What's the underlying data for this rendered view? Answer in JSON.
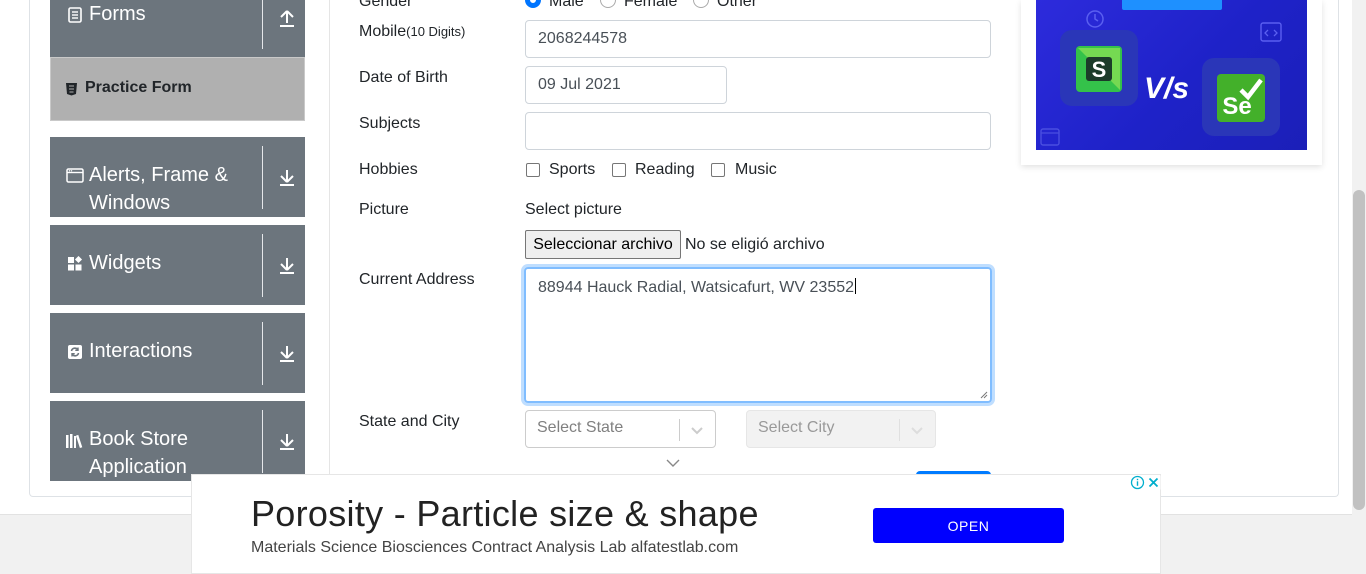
{
  "sidebar": {
    "groups": [
      {
        "title": "Forms",
        "icon": "form-icon"
      },
      {
        "title": "Alerts, Frame &",
        "title2": "Windows",
        "icon": "browser-window-icon"
      },
      {
        "title": "Widgets",
        "icon": "widgets-icon"
      },
      {
        "title": "Interactions",
        "icon": "interactions-icon"
      },
      {
        "title": "Book Store",
        "title2": "Application",
        "icon": "books-icon"
      }
    ],
    "active_item": "Practice Form"
  },
  "form": {
    "gender": {
      "label": "Gender",
      "options": [
        "Male",
        "Female",
        "Other"
      ],
      "selected": "Male"
    },
    "mobile": {
      "label": "Mobile",
      "hint": "(10 Digits)",
      "value": "2068244578"
    },
    "dob": {
      "label": "Date of Birth",
      "value": "09 Jul 2021"
    },
    "subjects": {
      "label": "Subjects",
      "value": ""
    },
    "hobbies": {
      "label": "Hobbies",
      "options": [
        "Sports",
        "Reading",
        "Music"
      ]
    },
    "picture": {
      "label": "Picture",
      "prompt": "Select picture",
      "button": "Seleccionar archivo",
      "status": "No se eligió archivo"
    },
    "address": {
      "label": "Current Address",
      "value": "88944 Hauck Radial, Watsicafurt, WV 23552"
    },
    "state_city": {
      "label": "State and City",
      "state_placeholder": "Select State",
      "city_placeholder": "Select City"
    }
  },
  "ad_bottom": {
    "headline": "Porosity - Particle size & shape",
    "subtext": "Materials Science Biosciences Contract Analysis Lab alfatestlab.com",
    "button": "OPEN"
  },
  "colors": {
    "sidebar": "#6c757d",
    "accent": "#0075ff",
    "ad_button": "#0000ff"
  }
}
